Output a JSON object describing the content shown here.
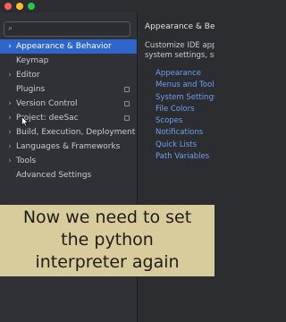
{
  "window": {
    "traffic_lights": {
      "close": "#ff5f57",
      "minimize": "#febc2e",
      "maximize": "#28c840"
    }
  },
  "sidebar": {
    "search_placeholder": "",
    "items": [
      {
        "label": "Appearance & Behavior",
        "expandable": true,
        "selected": true,
        "project_icon": false
      },
      {
        "label": "Keymap",
        "expandable": false,
        "selected": false,
        "project_icon": false
      },
      {
        "label": "Editor",
        "expandable": true,
        "selected": false,
        "project_icon": false
      },
      {
        "label": "Plugins",
        "expandable": false,
        "selected": false,
        "project_icon": true
      },
      {
        "label": "Version Control",
        "expandable": true,
        "selected": false,
        "project_icon": true
      },
      {
        "label": "Project: deeSac",
        "expandable": true,
        "selected": false,
        "project_icon": true
      },
      {
        "label": "Build, Execution, Deployment",
        "expandable": true,
        "selected": false,
        "project_icon": false
      },
      {
        "label": "Languages & Frameworks",
        "expandable": true,
        "selected": false,
        "project_icon": false
      },
      {
        "label": "Tools",
        "expandable": true,
        "selected": false,
        "project_icon": false
      },
      {
        "label": "Advanced Settings",
        "expandable": false,
        "selected": false,
        "project_icon": false
      }
    ]
  },
  "content": {
    "title": "Appearance & Beha",
    "description_line1": "Customize IDE app",
    "description_line2": "system settings, su",
    "links": [
      "Appearance",
      "Menus and Toolb",
      "System Settings",
      "File Colors",
      "Scopes",
      "Notifications",
      "Quick Lists",
      "Path Variables"
    ]
  },
  "caption": {
    "line1": "Now we need to set",
    "line2": "the python",
    "line3": "interpreter again"
  },
  "colors": {
    "selection": "#2f65ca",
    "link": "#6f9ff3",
    "caption_bg": "#d8cc9c"
  }
}
